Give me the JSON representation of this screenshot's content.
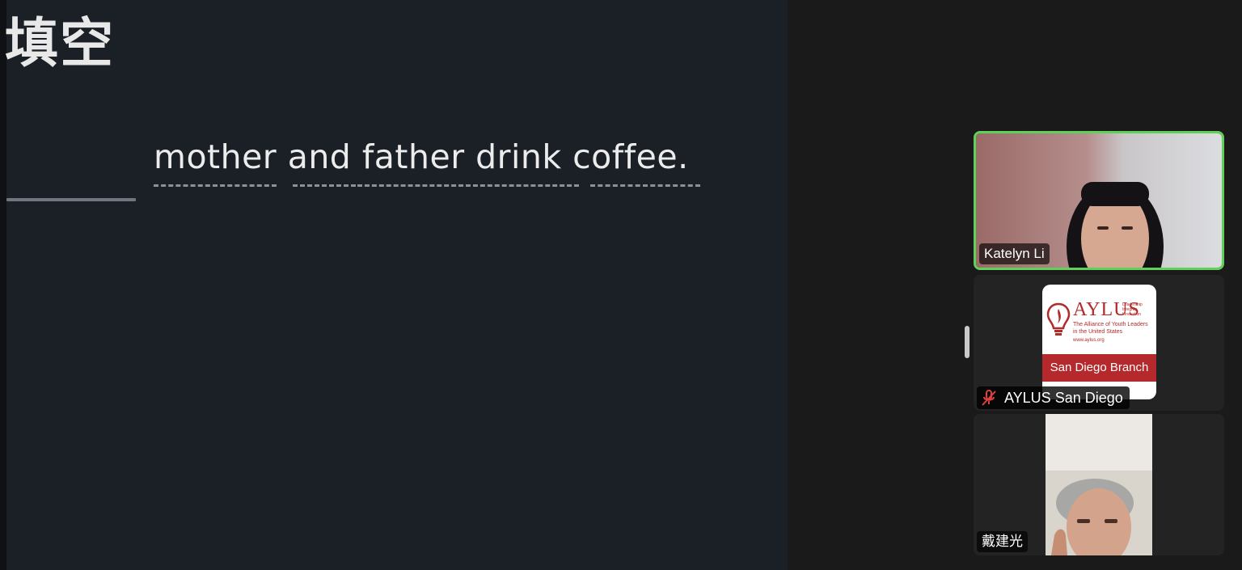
{
  "screen_share": {
    "title_fragment": "填空",
    "sentence": "mother and father drink coffee."
  },
  "participants": [
    {
      "name": "Katelyn Li",
      "active_speaker": true,
      "muted": false,
      "highlight_color": "#5fd15a"
    },
    {
      "name": "AYLUS San Diego",
      "active_speaker": false,
      "muted": true,
      "logo": {
        "wordmark": "AYLUS",
        "taglines": "Leadership Integrity Innovation",
        "subtitle": "The Alliance of Youth Leaders in the United States",
        "url": "www.aylus.org",
        "branch": "San Diego Branch"
      }
    },
    {
      "name": "戴建光",
      "active_speaker": false,
      "muted": false
    }
  ],
  "colors": {
    "share_bg": "#1b1f26",
    "panel_bg": "#1a1a1a",
    "brand_red": "#b5282c"
  }
}
